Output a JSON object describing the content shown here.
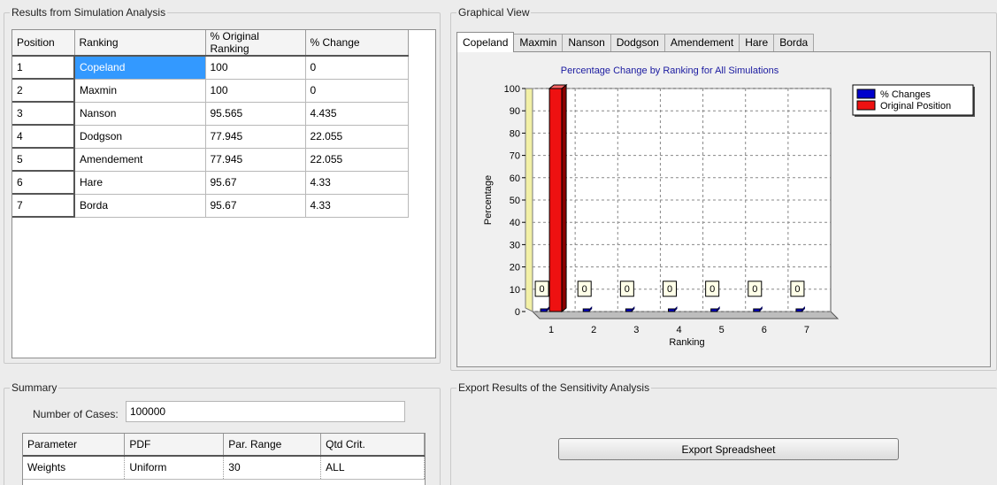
{
  "results": {
    "title": "Results from Simulation Analysis",
    "columns": [
      "Position",
      "Ranking",
      "% Original Ranking",
      "% Change"
    ],
    "rows": [
      [
        "1",
        "Copeland",
        "100",
        "0"
      ],
      [
        "2",
        "Maxmin",
        "100",
        "0"
      ],
      [
        "3",
        "Nanson",
        "95.565",
        "4.435"
      ],
      [
        "4",
        "Dodgson",
        "77.945",
        "22.055"
      ],
      [
        "5",
        "Amendement",
        "77.945",
        "22.055"
      ],
      [
        "6",
        "Hare",
        "95.67",
        "4.33"
      ],
      [
        "7",
        "Borda",
        "95.67",
        "4.33"
      ]
    ]
  },
  "graph": {
    "title": "Graphical View",
    "tabs": [
      "Copeland",
      "Maxmin",
      "Nanson",
      "Dodgson",
      "Amendement",
      "Hare",
      "Borda"
    ],
    "active_tab": "Copeland"
  },
  "chart_data": {
    "type": "bar",
    "title": "Percentage Change by Ranking for All Simulations",
    "xlabel": "Ranking",
    "ylabel": "Percentage",
    "ylim": [
      0,
      100
    ],
    "yticks": [
      0,
      10,
      20,
      30,
      40,
      50,
      60,
      70,
      80,
      90,
      100
    ],
    "categories": [
      "1",
      "2",
      "3",
      "4",
      "5",
      "6",
      "7"
    ],
    "series": [
      {
        "name": "% Changes",
        "color": "#0000cc",
        "values": [
          0,
          0,
          0,
          0,
          0,
          0,
          0
        ]
      },
      {
        "name": "Original Position",
        "color": "#ee1111",
        "values": [
          100,
          0,
          0,
          0,
          0,
          0,
          0
        ]
      }
    ],
    "data_labels": [
      "0",
      "0",
      "0",
      "0",
      "0",
      "0",
      "0"
    ],
    "grid": true,
    "legend": "top-right"
  },
  "summary": {
    "title": "Summary",
    "cases_label": "Number of Cases:",
    "cases_value": "100000",
    "columns": [
      "Parameter",
      "PDF",
      "Par. Range",
      "Qtd Crit."
    ],
    "rows": [
      [
        "Weights",
        "Uniform",
        "30",
        "ALL"
      ]
    ]
  },
  "export": {
    "title": "Export Results of the Sensitivity Analysis",
    "button_label": "Export Spreadsheet"
  }
}
